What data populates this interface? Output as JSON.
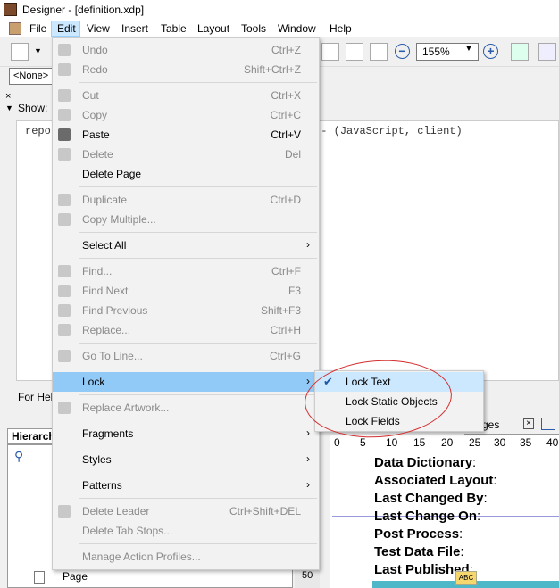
{
  "window": {
    "title": "Designer - [definition.xdp]"
  },
  "menubar": {
    "items": [
      "File",
      "Edit",
      "View",
      "Insert",
      "Table",
      "Layout",
      "Tools",
      "Window",
      "Help"
    ]
  },
  "toolbar": {
    "zoom": "155%"
  },
  "object_combo": {
    "value": "<None>"
  },
  "script_editor": {
    "show_label": "Show:",
    "text": "repo                                   ialize - (JavaScript, client)",
    "help_text": "For Hel"
  },
  "hierarchy": {
    "tab_label": "Hierarch",
    "page_item": "Page",
    "scroll_value": "50"
  },
  "canvas": {
    "tab_label": "ges",
    "ruler": [
      "0",
      "5",
      "10",
      "15",
      "20",
      "25",
      "30",
      "35",
      "40"
    ],
    "fields": [
      "Data Dictionary",
      "Associated Layout",
      "Last Changed By",
      "Last Change On",
      "Post Process",
      "Test Data File",
      "Last Published"
    ],
    "field_suffix": ":",
    "icon_label": "ABC"
  },
  "edit_menu": {
    "items": [
      {
        "label": "Undo",
        "shortcut": "Ctrl+Z",
        "enabled": false,
        "icon": "undo-icon"
      },
      {
        "label": "Redo",
        "shortcut": "Shift+Ctrl+Z",
        "enabled": false,
        "icon": "redo-icon"
      },
      {
        "label": "Cut",
        "shortcut": "Ctrl+X",
        "enabled": false,
        "icon": "cut-icon"
      },
      {
        "label": "Copy",
        "shortcut": "Ctrl+C",
        "enabled": false,
        "icon": "copy-icon"
      },
      {
        "label": "Paste",
        "shortcut": "Ctrl+V",
        "enabled": true,
        "icon": "paste-icon"
      },
      {
        "label": "Delete",
        "shortcut": "Del",
        "enabled": false,
        "icon": "delete-icon"
      },
      {
        "label": "Delete Page",
        "shortcut": "",
        "enabled": true,
        "icon": ""
      },
      {
        "label": "Duplicate",
        "shortcut": "Ctrl+D",
        "enabled": false,
        "icon": "duplicate-icon"
      },
      {
        "label": "Copy Multiple...",
        "shortcut": "",
        "enabled": false,
        "icon": "copy-multiple-icon"
      },
      {
        "label": "Select All",
        "shortcut": "",
        "enabled": true,
        "icon": "",
        "submenu": true
      },
      {
        "label": "Find...",
        "shortcut": "Ctrl+F",
        "enabled": false,
        "icon": "binoculars-icon"
      },
      {
        "label": "Find Next",
        "shortcut": "F3",
        "enabled": false,
        "icon": "find-next-icon"
      },
      {
        "label": "Find Previous",
        "shortcut": "Shift+F3",
        "enabled": false,
        "icon": "find-previous-icon"
      },
      {
        "label": "Replace...",
        "shortcut": "Ctrl+H",
        "enabled": false,
        "icon": "replace-icon"
      },
      {
        "label": "Go To Line...",
        "shortcut": "Ctrl+G",
        "enabled": false,
        "icon": "goto-line-icon"
      },
      {
        "label": "Lock",
        "shortcut": "",
        "enabled": true,
        "icon": "",
        "submenu": true,
        "highlighted": true
      },
      {
        "label": "Replace Artwork...",
        "shortcut": "",
        "enabled": false,
        "icon": "replace-artwork-icon"
      },
      {
        "label": "Fragments",
        "shortcut": "",
        "enabled": true,
        "icon": "",
        "submenu": true
      },
      {
        "label": "Styles",
        "shortcut": "",
        "enabled": true,
        "icon": "",
        "submenu": true
      },
      {
        "label": "Patterns",
        "shortcut": "",
        "enabled": true,
        "icon": "",
        "submenu": true
      },
      {
        "label": "Delete Leader",
        "shortcut": "Ctrl+Shift+DEL",
        "enabled": false,
        "icon": "delete-leader-icon"
      },
      {
        "label": "Delete Tab Stops...",
        "shortcut": "",
        "enabled": false,
        "icon": ""
      },
      {
        "label": "Manage Action Profiles...",
        "shortcut": "",
        "enabled": false,
        "icon": ""
      }
    ]
  },
  "lock_submenu": {
    "items": [
      {
        "label": "Lock Text",
        "checked": true
      },
      {
        "label": "Lock Static Objects",
        "checked": false
      },
      {
        "label": "Lock Fields",
        "checked": false
      }
    ]
  },
  "colors": {
    "highlight": "#91c9f7",
    "annotation": "#d43030",
    "accent": "#4fb8c8"
  }
}
